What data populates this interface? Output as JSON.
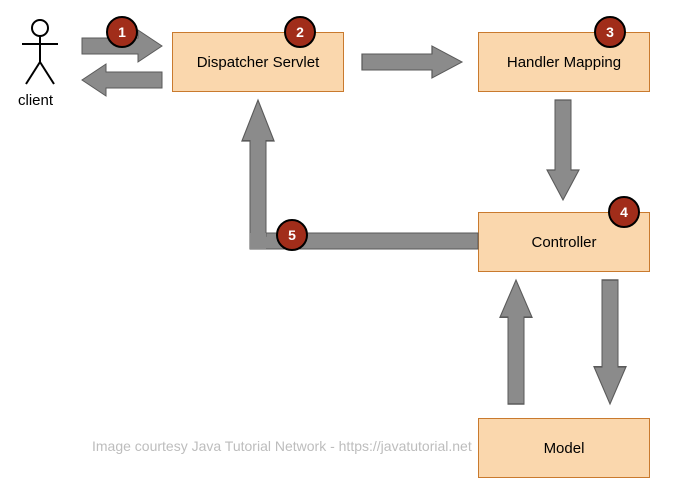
{
  "client_label": "client",
  "boxes": {
    "dispatcher": "Dispatcher Servlet",
    "handler": "Handler Mapping",
    "controller": "Controller",
    "model": "Model"
  },
  "steps": {
    "s1": "1",
    "s2": "2",
    "s3": "3",
    "s4": "4",
    "s5": "5"
  },
  "credit": "Image courtesy Java Tutorial Network - https://javatutorial.net",
  "colors": {
    "box_fill": "#fad7ad",
    "box_border": "#c97a2e",
    "badge_fill": "#a12d1a",
    "arrow": "#8b8b8b",
    "arrow_stroke": "#5a5a5a"
  }
}
